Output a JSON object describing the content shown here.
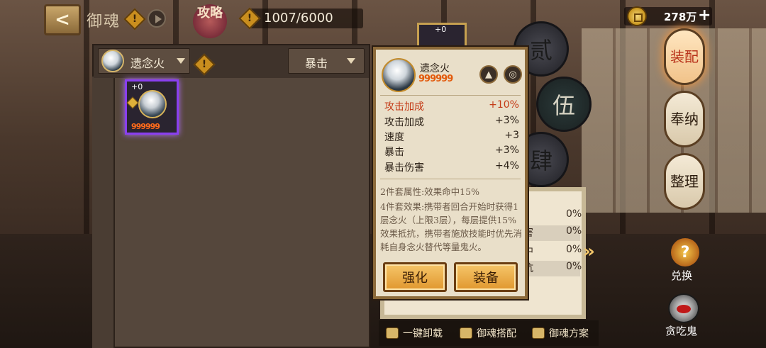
{
  "header": {
    "back_icon": "back-arrow-icon",
    "title": "御魂",
    "guide_label": "攻略",
    "soul_count": "1007/6000",
    "coins": "278万"
  },
  "inventory": {
    "set_filter": "遗念火",
    "stat_filter": "暴击",
    "items": [
      {
        "level": "+0",
        "stars": "999999"
      }
    ]
  },
  "slot_tags": [
    "贰",
    "伍",
    "肆"
  ],
  "peek_card": {
    "level": "+0"
  },
  "tooltip": {
    "name": "遗念火",
    "stars": "999999",
    "main_stat": {
      "label": "攻击加成",
      "value": "+10%"
    },
    "sub_stats": [
      {
        "label": "攻击加成",
        "value": "+3%"
      },
      {
        "label": "速度",
        "value": "+3"
      },
      {
        "label": "暴击",
        "value": "+3%"
      },
      {
        "label": "暴击伤害",
        "value": "+4%"
      }
    ],
    "set2": "2件套属性:效果命中15%",
    "set4": "4件套效果:携带者回合开始时获得1层念火（上限3层），每层提供15%效果抵抗，携带者施放技能时优先消耗自身念火替代等量鬼火。",
    "enhance_label": "强化",
    "equip_label": "装备"
  },
  "attributes": [
    {
      "label": "",
      "value": "0%"
    },
    {
      "label": "害",
      "value": "0%"
    },
    {
      "label": "中",
      "value": "0%"
    },
    {
      "label": "抗",
      "value": "0%"
    }
  ],
  "side_menu": {
    "equip": "装配",
    "offer": "奉纳",
    "sort": "整理",
    "exchange": "兑换",
    "ghost": "贪吃鬼"
  },
  "bottom_bar": {
    "unequip_all": "一键卸载",
    "match": "御魂搭配",
    "plan": "御魂方案"
  }
}
